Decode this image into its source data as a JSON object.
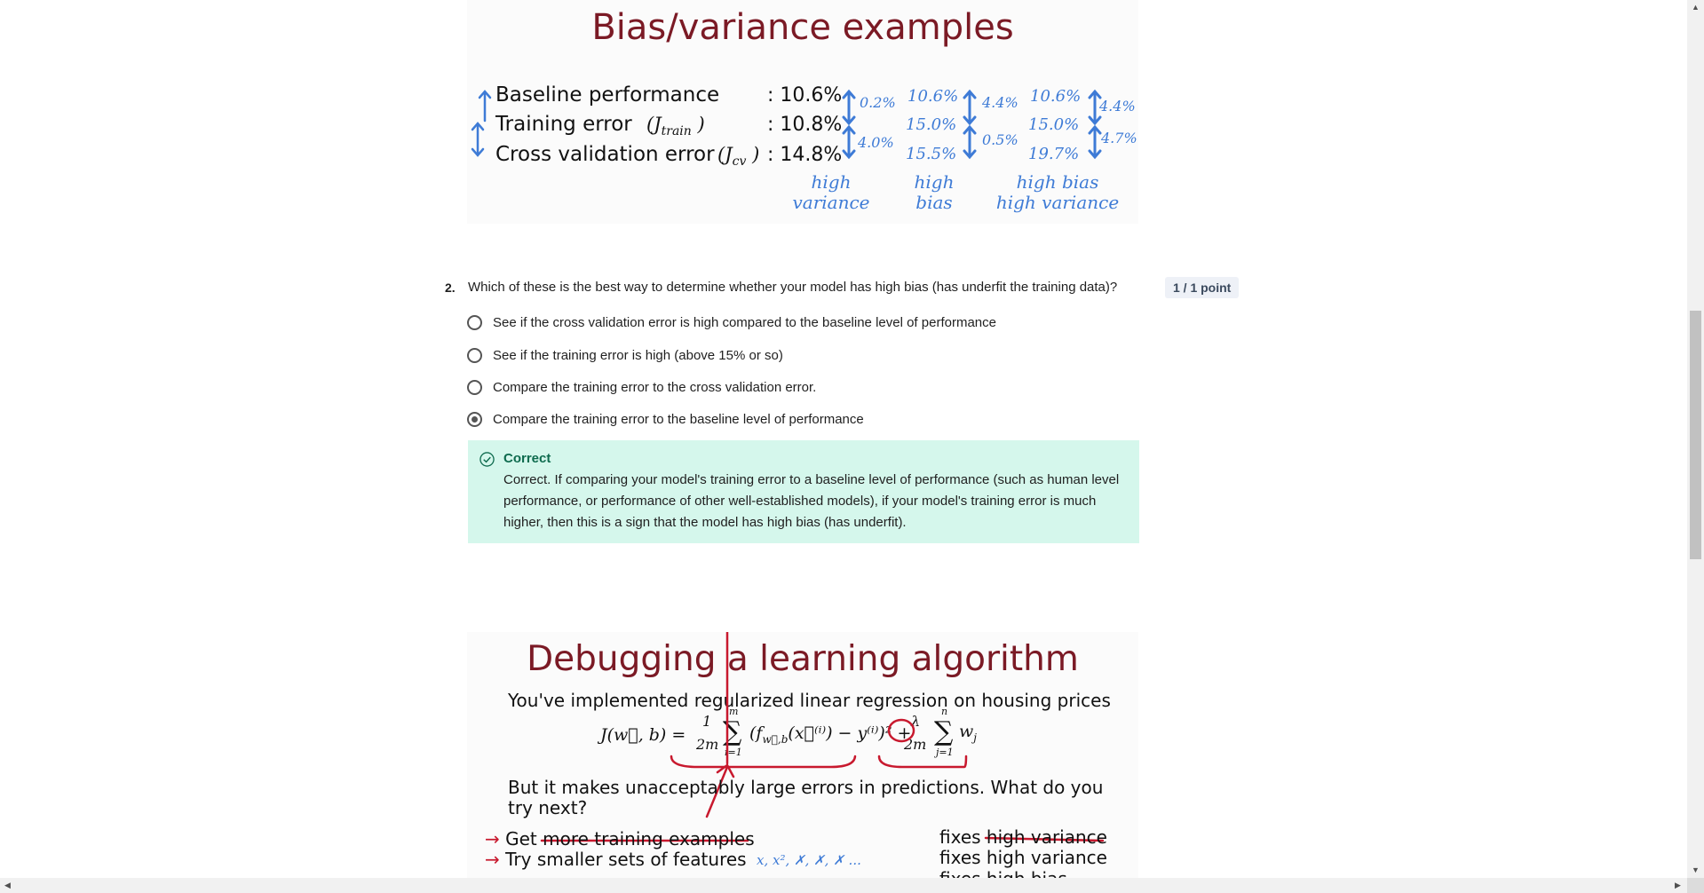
{
  "slide1": {
    "title": "Bias/variance examples",
    "rows": [
      {
        "label": "Baseline performance",
        "symbol": "",
        "value": ": 10.6%"
      },
      {
        "label": "Training error",
        "symbol": "(J",
        "sub": "train",
        "close": ")",
        "value": ": 10.8%"
      },
      {
        "label": "Cross validation error",
        "symbol": "(J",
        "sub": "cv",
        "close": ")",
        "value": ": 14.8%"
      }
    ],
    "example1": {
      "diff_top": "0.2%",
      "diff_bottom": "4.0%",
      "caption_line1": "high",
      "caption_line2": "variance"
    },
    "example2": {
      "baseline": "10.6%",
      "train": "15.0%",
      "cv": "15.5%",
      "diff_top": "4.4%",
      "diff_bottom": "0.5%",
      "caption_line1": "high",
      "caption_line2": "bias"
    },
    "example3": {
      "baseline": "10.6%",
      "train": "15.0%",
      "cv": "19.7%",
      "diff_top": "4.4%",
      "diff_bottom": "4.7%",
      "caption_line1": "high bias",
      "caption_line2": "high variance"
    },
    "colors": {
      "title": "#7b1a25",
      "handwriting": "#3e7bd6"
    }
  },
  "question": {
    "number": "2.",
    "text": "Which of these is the best way to determine whether your model has high bias (has underfit the training data)?",
    "points": "1 / 1 point",
    "options": [
      {
        "label": "See if the cross validation error is high compared to the baseline level of performance",
        "selected": false
      },
      {
        "label": "See if the training error is high (above 15% or so)",
        "selected": false
      },
      {
        "label": "Compare the training error to the cross validation error.",
        "selected": false
      },
      {
        "label": "Compare the training error to the baseline level of performance",
        "selected": true
      }
    ],
    "feedback": {
      "title": "Correct",
      "text": "Correct. If comparing your model's training error to a baseline level of performance (such as human level performance, or performance of other well-established models), if your model's training error is much higher, then this is a sign that the model has high bias (has underfit).",
      "color": "#d5f7ec"
    }
  },
  "slide2": {
    "title": "Debugging a learning algorithm",
    "subtitle": "You've implemented regularized linear regression on housing prices",
    "formula_left": "J(w⃗, b) =",
    "formula_frac1_num": "1",
    "formula_frac1_den": "2m",
    "formula_sum1": "(f",
    "formula_sum1_sub": "w⃗,b",
    "formula_sum1_rest": "(x⃗⁽ⁱ⁾) − y⁽ⁱ⁾)² +",
    "formula_frac2_num": "λ",
    "formula_frac2_den": "2m",
    "formula_sum2": "w",
    "formula_sum2_sub": "j",
    "sum1_top": "m",
    "sum1_bottom": "i=1",
    "sum2_top": "n",
    "sum2_bottom": "j=1",
    "question_line1": "But it makes unacceptably large errors in predictions. What do you",
    "question_line2": "try next?",
    "actions": [
      {
        "arrow": "→",
        "text": "Get more training examples",
        "fix": "fixes high variance"
      },
      {
        "arrow": "→",
        "text": "Try smaller sets of features",
        "fix": "fixes high variance"
      }
    ],
    "feature_note": "x, x², ✗, ✗, ✗ ...",
    "partial_fix": "fixes high bias"
  }
}
